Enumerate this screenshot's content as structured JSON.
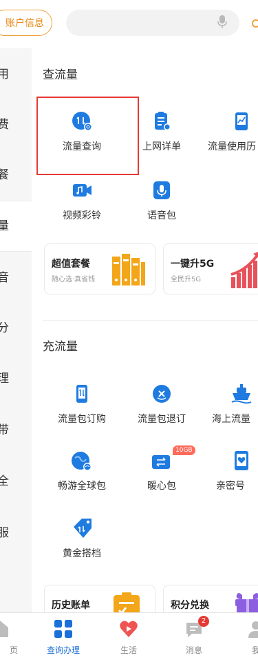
{
  "header": {
    "account_button": "账户信息",
    "search_placeholder": ""
  },
  "sidebar": {
    "items": [
      {
        "label": "用"
      },
      {
        "label": "费"
      },
      {
        "label": "餐"
      },
      {
        "label": "量",
        "active": true
      },
      {
        "label": "音"
      },
      {
        "label": "分"
      },
      {
        "label": "理"
      },
      {
        "label": "带"
      },
      {
        "label": "全"
      },
      {
        "label": "服"
      }
    ]
  },
  "query_section": {
    "title": "查流量",
    "items": [
      {
        "label": "流量查询",
        "icon": "traffic-query-icon"
      },
      {
        "label": "上网详单",
        "icon": "internet-detail-icon"
      },
      {
        "label": "流量使用历",
        "icon": "usage-history-icon"
      },
      {
        "label": "视频彩铃",
        "icon": "video-ringtone-icon"
      },
      {
        "label": "语音包",
        "icon": "voice-pack-icon"
      }
    ]
  },
  "promo_cards": [
    {
      "title": "超值套餐",
      "subtitle": "随心选·真省钱"
    },
    {
      "title": "一键升5G",
      "subtitle": "全民升5G"
    }
  ],
  "recharge_section": {
    "title": "充流量",
    "items": [
      {
        "label": "流量包订购",
        "icon": "package-order-icon"
      },
      {
        "label": "流量包退订",
        "icon": "package-cancel-icon"
      },
      {
        "label": "海上流量",
        "icon": "sea-traffic-icon"
      },
      {
        "label": "畅游全球包",
        "icon": "global-roaming-icon"
      },
      {
        "label": "暖心包",
        "icon": "warm-pack-icon",
        "tag": "10GB"
      },
      {
        "label": "亲密号",
        "icon": "intimate-number-icon"
      },
      {
        "label": "黄金搭档",
        "icon": "golden-partner-icon"
      }
    ]
  },
  "bottom_cards": [
    {
      "title": "历史账单"
    },
    {
      "title": "积分兑换"
    }
  ],
  "tabbar": {
    "tabs": [
      {
        "label": "页"
      },
      {
        "label": "查询办理",
        "active": true
      },
      {
        "label": "生活"
      },
      {
        "label": "消息",
        "badge": "2"
      },
      {
        "label": "我"
      }
    ]
  },
  "colors": {
    "accent_blue": "#1a6fd8",
    "accent_orange": "#e98a18",
    "highlight_red": "#e53935"
  }
}
